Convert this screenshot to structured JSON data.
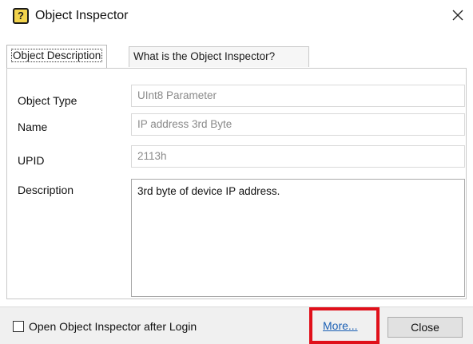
{
  "window": {
    "title": "Object Inspector",
    "title_icon_glyph": "?",
    "icons": [
      "help-book-icon",
      "close-icon"
    ]
  },
  "tabs": [
    {
      "label": "Object Description",
      "active": true
    },
    {
      "label": "What is the Object Inspector?",
      "active": false
    }
  ],
  "fields": {
    "object_type": {
      "label": "Object Type",
      "value": "UInt8 Parameter"
    },
    "name": {
      "label": "Name",
      "value": "IP address 3rd Byte"
    },
    "upid": {
      "label": "UPID",
      "value": "2113h"
    },
    "description": {
      "label": "Description",
      "value": "3rd byte of device IP address."
    }
  },
  "footer": {
    "checkbox_label": "Open Object Inspector after Login",
    "checkbox_checked": false,
    "more_link": "More...",
    "close_button": "Close"
  },
  "colors": {
    "highlight": "#e0101a",
    "link": "#1a5fb4"
  }
}
